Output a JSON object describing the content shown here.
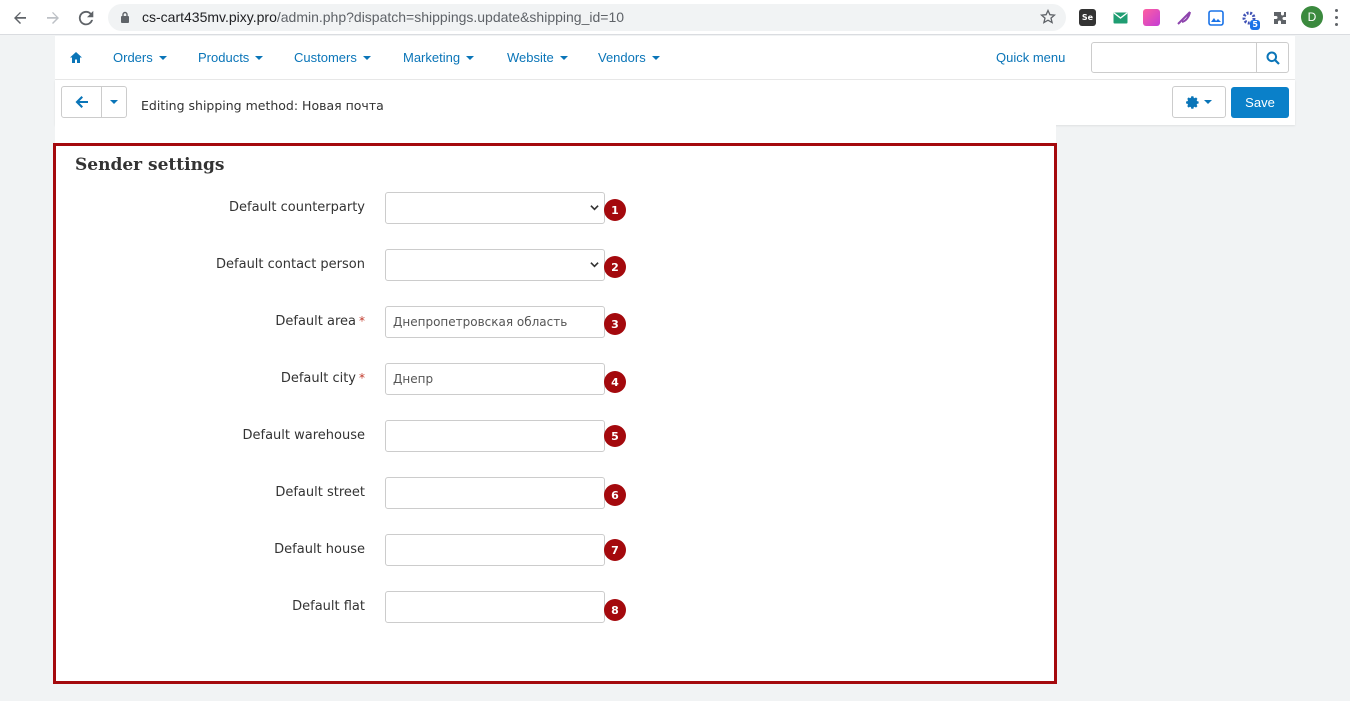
{
  "browser": {
    "url_host": "cs-cart435mv.pixy.pro",
    "url_path": "/admin.php?dispatch=shippings.update&shipping_id=10",
    "extension_badge": "5",
    "profile_initial": "D",
    "se_label": "Se"
  },
  "nav": {
    "items": [
      {
        "label": "Orders"
      },
      {
        "label": "Products"
      },
      {
        "label": "Customers"
      },
      {
        "label": "Marketing"
      },
      {
        "label": "Website"
      },
      {
        "label": "Vendors"
      }
    ],
    "quick_menu": "Quick menu",
    "search_value": ""
  },
  "toolbar": {
    "title": "Editing shipping method: Новая почта",
    "save_label": "Save"
  },
  "section": {
    "title": "Sender settings"
  },
  "fields": [
    {
      "label": "Default counterparty",
      "type": "select",
      "value": "",
      "required": false,
      "marker": "1"
    },
    {
      "label": "Default contact person",
      "type": "select",
      "value": "",
      "required": false,
      "marker": "2"
    },
    {
      "label": "Default area",
      "type": "input",
      "value": "Днепропетровская область",
      "required": true,
      "marker": "3"
    },
    {
      "label": "Default city",
      "type": "input",
      "value": "Днепр",
      "required": true,
      "marker": "4"
    },
    {
      "label": "Default warehouse",
      "type": "input",
      "value": "",
      "required": false,
      "marker": "5"
    },
    {
      "label": "Default street",
      "type": "input",
      "value": "",
      "required": false,
      "marker": "6"
    },
    {
      "label": "Default house",
      "type": "input",
      "value": "",
      "required": false,
      "marker": "7"
    },
    {
      "label": "Default flat",
      "type": "input",
      "value": "",
      "required": false,
      "marker": "8"
    }
  ],
  "required_mark": "*",
  "colors": {
    "accent": "#0a75b8",
    "save_button": "#0a80c9",
    "annotation": "#a4090d",
    "page_background": "#f1f3f4"
  },
  "icons": [
    "back-arrow-icon",
    "forward-arrow-icon",
    "reload-icon",
    "lock-icon",
    "star-icon",
    "home-icon",
    "search-icon",
    "gear-icon",
    "chevron-down-icon",
    "extensions-puzzle-icon"
  ]
}
